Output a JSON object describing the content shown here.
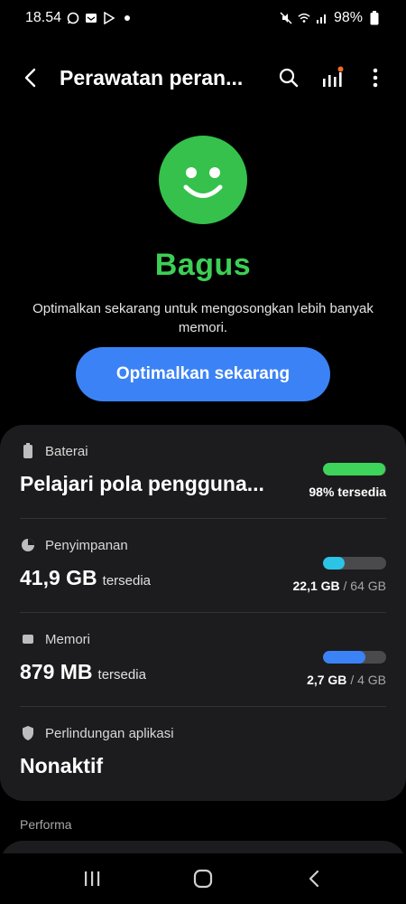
{
  "status_bar": {
    "time": "18.54",
    "battery": "98%",
    "left_icons": [
      "whatsapp-icon",
      "email-icon",
      "play-store-icon",
      "dot-icon"
    ],
    "right_icons": [
      "mute-icon",
      "wifi-icon",
      "signal-icon",
      "battery-icon"
    ]
  },
  "app_bar": {
    "title": "Perawatan peran...",
    "actions": [
      "search-icon",
      "stats-icon",
      "more-options-icon"
    ]
  },
  "hero": {
    "status": "Bagus",
    "description": "Optimalkan sekarang untuk mengosongkan lebih banyak memori.",
    "button_label": "Optimalkan sekarang"
  },
  "colors": {
    "accent_green": "#35c14b",
    "battery_bar": "#3ed35a",
    "storage_bar": "#2bc4e6",
    "memory_bar": "#3b82f6",
    "button_blue": "#3b82f6"
  },
  "battery": {
    "label": "Baterai",
    "value": "Pelajari pola pengguna...",
    "caption": "98% tersedia",
    "level": 0.98
  },
  "storage": {
    "label": "Penyimpanan",
    "value": "41,9 GB",
    "unit": "tersedia",
    "used": "22,1 GB",
    "total": "/ 64 GB",
    "level": 0.345
  },
  "memory": {
    "label": "Memori",
    "value": "879 MB",
    "unit": "tersedia",
    "used": "2,7 GB",
    "total": "/ 4 GB",
    "level": 0.675
  },
  "app_protection": {
    "label": "Perlindungan aplikasi",
    "value": "Nonaktif"
  },
  "section": {
    "performance_heading": "Performa"
  }
}
